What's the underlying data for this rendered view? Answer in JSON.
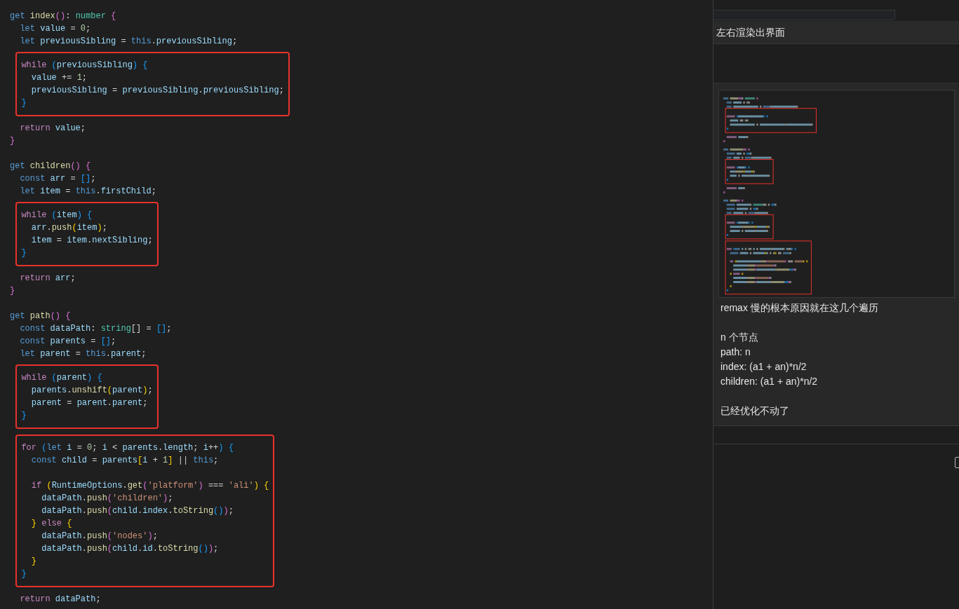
{
  "editor": {
    "blocks": [
      {
        "highlighted": false,
        "lines": [
          {
            "kind": "code",
            "tokens": [
              {
                "text": "get",
                "kind": "storage"
              },
              {
                "text": " index",
                "kind": "function"
              },
              {
                "text": "()",
                "kind": "bracket2"
              },
              {
                "text": ": ",
                "kind": "plain"
              },
              {
                "text": "number",
                "kind": "type"
              },
              {
                "text": " {",
                "kind": "bracket2"
              }
            ]
          },
          {
            "kind": "code",
            "tokens": [
              {
                "text": "  let",
                "kind": "storage"
              },
              {
                "text": " value",
                "kind": "variable"
              },
              {
                "text": " = ",
                "kind": "plain"
              },
              {
                "text": "0",
                "kind": "number"
              },
              {
                "text": ";",
                "kind": "plain"
              }
            ]
          },
          {
            "kind": "code",
            "tokens": [
              {
                "text": "  let",
                "kind": "storage"
              },
              {
                "text": " previousSibling",
                "kind": "variable"
              },
              {
                "text": " = ",
                "kind": "plain"
              },
              {
                "text": "this",
                "kind": "storage"
              },
              {
                "text": ".",
                "kind": "plain"
              },
              {
                "text": "previousSibling",
                "kind": "variable"
              },
              {
                "text": ";",
                "kind": "plain"
              }
            ]
          }
        ]
      },
      {
        "highlighted": true,
        "lines": [
          {
            "kind": "code",
            "tokens": [
              {
                "text": "  while",
                "kind": "control"
              },
              {
                "text": " (",
                "kind": "bracket3"
              },
              {
                "text": "previousSibling",
                "kind": "variable"
              },
              {
                "text": ")",
                "kind": "bracket3"
              },
              {
                "text": " {",
                "kind": "bracket3"
              }
            ]
          },
          {
            "kind": "code",
            "tokens": [
              {
                "text": "    value",
                "kind": "variable"
              },
              {
                "text": " += ",
                "kind": "plain"
              },
              {
                "text": "1",
                "kind": "number"
              },
              {
                "text": ";",
                "kind": "plain"
              }
            ]
          },
          {
            "kind": "code",
            "tokens": [
              {
                "text": "    previousSibling",
                "kind": "variable"
              },
              {
                "text": " = ",
                "kind": "plain"
              },
              {
                "text": "previousSibling",
                "kind": "variable"
              },
              {
                "text": ".",
                "kind": "plain"
              },
              {
                "text": "previousSibling",
                "kind": "variable"
              },
              {
                "text": ";",
                "kind": "plain"
              }
            ]
          },
          {
            "kind": "code",
            "tokens": [
              {
                "text": "  }",
                "kind": "bracket3"
              }
            ]
          }
        ]
      },
      {
        "highlighted": false,
        "lines": [
          {
            "kind": "code",
            "tokens": [
              {
                "text": "  return",
                "kind": "control"
              },
              {
                "text": " value",
                "kind": "variable"
              },
              {
                "text": ";",
                "kind": "plain"
              }
            ]
          },
          {
            "kind": "code",
            "tokens": [
              {
                "text": "}",
                "kind": "bracket2"
              }
            ]
          },
          {
            "kind": "blank"
          },
          {
            "kind": "code",
            "tokens": [
              {
                "text": "get",
                "kind": "storage"
              },
              {
                "text": " children",
                "kind": "function"
              },
              {
                "text": "()",
                "kind": "bracket2"
              },
              {
                "text": " {",
                "kind": "bracket2"
              }
            ]
          },
          {
            "kind": "code",
            "tokens": [
              {
                "text": "  const",
                "kind": "storage"
              },
              {
                "text": " arr",
                "kind": "variable"
              },
              {
                "text": " = ",
                "kind": "plain"
              },
              {
                "text": "[]",
                "kind": "bracket3"
              },
              {
                "text": ";",
                "kind": "plain"
              }
            ]
          },
          {
            "kind": "code",
            "tokens": [
              {
                "text": "  let",
                "kind": "storage"
              },
              {
                "text": " item",
                "kind": "variable"
              },
              {
                "text": " = ",
                "kind": "plain"
              },
              {
                "text": "this",
                "kind": "storage"
              },
              {
                "text": ".",
                "kind": "plain"
              },
              {
                "text": "firstChild",
                "kind": "variable"
              },
              {
                "text": ";",
                "kind": "plain"
              }
            ]
          }
        ]
      },
      {
        "highlighted": true,
        "lines": [
          {
            "kind": "code",
            "tokens": [
              {
                "text": "  while",
                "kind": "control"
              },
              {
                "text": " (",
                "kind": "bracket3"
              },
              {
                "text": "item",
                "kind": "variable"
              },
              {
                "text": ")",
                "kind": "bracket3"
              },
              {
                "text": " {",
                "kind": "bracket3"
              }
            ]
          },
          {
            "kind": "code",
            "tokens": [
              {
                "text": "    arr",
                "kind": "variable"
              },
              {
                "text": ".",
                "kind": "plain"
              },
              {
                "text": "push",
                "kind": "function"
              },
              {
                "text": "(",
                "kind": "bracket1"
              },
              {
                "text": "item",
                "kind": "variable"
              },
              {
                "text": ")",
                "kind": "bracket1"
              },
              {
                "text": ";",
                "kind": "plain"
              }
            ]
          },
          {
            "kind": "code",
            "tokens": [
              {
                "text": "    item",
                "kind": "variable"
              },
              {
                "text": " = ",
                "kind": "plain"
              },
              {
                "text": "item",
                "kind": "variable"
              },
              {
                "text": ".",
                "kind": "plain"
              },
              {
                "text": "nextSibling",
                "kind": "variable"
              },
              {
                "text": ";",
                "kind": "plain"
              }
            ]
          },
          {
            "kind": "code",
            "tokens": [
              {
                "text": "  }",
                "kind": "bracket3"
              }
            ]
          }
        ]
      },
      {
        "highlighted": false,
        "lines": [
          {
            "kind": "code",
            "tokens": [
              {
                "text": "  return",
                "kind": "control"
              },
              {
                "text": " arr",
                "kind": "variable"
              },
              {
                "text": ";",
                "kind": "plain"
              }
            ]
          },
          {
            "kind": "code",
            "tokens": [
              {
                "text": "}",
                "kind": "bracket2"
              }
            ]
          },
          {
            "kind": "blank"
          },
          {
            "kind": "code",
            "tokens": [
              {
                "text": "get",
                "kind": "storage"
              },
              {
                "text": " path",
                "kind": "function"
              },
              {
                "text": "()",
                "kind": "bracket2"
              },
              {
                "text": " {",
                "kind": "bracket2"
              }
            ]
          },
          {
            "kind": "code",
            "tokens": [
              {
                "text": "  const",
                "kind": "storage"
              },
              {
                "text": " dataPath",
                "kind": "variable"
              },
              {
                "text": ": ",
                "kind": "plain"
              },
              {
                "text": "string",
                "kind": "type"
              },
              {
                "text": "[]",
                "kind": "plain"
              },
              {
                "text": " = ",
                "kind": "plain"
              },
              {
                "text": "[]",
                "kind": "bracket3"
              },
              {
                "text": ";",
                "kind": "plain"
              }
            ]
          },
          {
            "kind": "code",
            "tokens": [
              {
                "text": "  const",
                "kind": "storage"
              },
              {
                "text": " parents",
                "kind": "variable"
              },
              {
                "text": " = ",
                "kind": "plain"
              },
              {
                "text": "[]",
                "kind": "bracket3"
              },
              {
                "text": ";",
                "kind": "plain"
              }
            ]
          },
          {
            "kind": "code",
            "tokens": [
              {
                "text": "  let",
                "kind": "storage"
              },
              {
                "text": " parent",
                "kind": "variable"
              },
              {
                "text": " = ",
                "kind": "plain"
              },
              {
                "text": "this",
                "kind": "storage"
              },
              {
                "text": ".",
                "kind": "plain"
              },
              {
                "text": "parent",
                "kind": "variable"
              },
              {
                "text": ";",
                "kind": "plain"
              }
            ]
          }
        ]
      },
      {
        "highlighted": true,
        "lines": [
          {
            "kind": "code",
            "tokens": [
              {
                "text": "  while",
                "kind": "control"
              },
              {
                "text": " (",
                "kind": "bracket3"
              },
              {
                "text": "parent",
                "kind": "variable"
              },
              {
                "text": ")",
                "kind": "bracket3"
              },
              {
                "text": " {",
                "kind": "bracket3"
              }
            ]
          },
          {
            "kind": "code",
            "tokens": [
              {
                "text": "    parents",
                "kind": "variable"
              },
              {
                "text": ".",
                "kind": "plain"
              },
              {
                "text": "unshift",
                "kind": "function"
              },
              {
                "text": "(",
                "kind": "bracket1"
              },
              {
                "text": "parent",
                "kind": "variable"
              },
              {
                "text": ")",
                "kind": "bracket1"
              },
              {
                "text": ";",
                "kind": "plain"
              }
            ]
          },
          {
            "kind": "code",
            "tokens": [
              {
                "text": "    parent",
                "kind": "variable"
              },
              {
                "text": " = ",
                "kind": "plain"
              },
              {
                "text": "parent",
                "kind": "variable"
              },
              {
                "text": ".",
                "kind": "plain"
              },
              {
                "text": "parent",
                "kind": "variable"
              },
              {
                "text": ";",
                "kind": "plain"
              }
            ]
          },
          {
            "kind": "code",
            "tokens": [
              {
                "text": "  }",
                "kind": "bracket3"
              }
            ]
          }
        ]
      },
      {
        "highlighted": true,
        "lines": [
          {
            "kind": "code",
            "tokens": [
              {
                "text": "  for",
                "kind": "control"
              },
              {
                "text": " (",
                "kind": "bracket3"
              },
              {
                "text": "let",
                "kind": "storage"
              },
              {
                "text": " i",
                "kind": "variable"
              },
              {
                "text": " = ",
                "kind": "plain"
              },
              {
                "text": "0",
                "kind": "number"
              },
              {
                "text": "; ",
                "kind": "plain"
              },
              {
                "text": "i",
                "kind": "variable"
              },
              {
                "text": " < ",
                "kind": "plain"
              },
              {
                "text": "parents",
                "kind": "variable"
              },
              {
                "text": ".",
                "kind": "plain"
              },
              {
                "text": "length",
                "kind": "variable"
              },
              {
                "text": "; ",
                "kind": "plain"
              },
              {
                "text": "i",
                "kind": "variable"
              },
              {
                "text": "++",
                "kind": "plain"
              },
              {
                "text": ")",
                "kind": "bracket3"
              },
              {
                "text": " {",
                "kind": "bracket3"
              }
            ]
          },
          {
            "kind": "code",
            "tokens": [
              {
                "text": "    const",
                "kind": "storage"
              },
              {
                "text": " child",
                "kind": "variable"
              },
              {
                "text": " = ",
                "kind": "plain"
              },
              {
                "text": "parents",
                "kind": "variable"
              },
              {
                "text": "[",
                "kind": "bracket1"
              },
              {
                "text": "i",
                "kind": "variable"
              },
              {
                "text": " + ",
                "kind": "plain"
              },
              {
                "text": "1",
                "kind": "number"
              },
              {
                "text": "]",
                "kind": "bracket1"
              },
              {
                "text": " || ",
                "kind": "plain"
              },
              {
                "text": "this",
                "kind": "storage"
              },
              {
                "text": ";",
                "kind": "plain"
              }
            ]
          },
          {
            "kind": "blank"
          },
          {
            "kind": "code",
            "tokens": [
              {
                "text": "    if",
                "kind": "control"
              },
              {
                "text": " (",
                "kind": "bracket1"
              },
              {
                "text": "RuntimeOptions",
                "kind": "variable"
              },
              {
                "text": ".",
                "kind": "plain"
              },
              {
                "text": "get",
                "kind": "function"
              },
              {
                "text": "(",
                "kind": "bracket2"
              },
              {
                "text": "'platform'",
                "kind": "string"
              },
              {
                "text": ")",
                "kind": "bracket2"
              },
              {
                "text": " === ",
                "kind": "plain"
              },
              {
                "text": "'ali'",
                "kind": "string"
              },
              {
                "text": ")",
                "kind": "bracket1"
              },
              {
                "text": " {",
                "kind": "bracket1"
              }
            ]
          },
          {
            "kind": "code",
            "tokens": [
              {
                "text": "      dataPath",
                "kind": "variable"
              },
              {
                "text": ".",
                "kind": "plain"
              },
              {
                "text": "push",
                "kind": "function"
              },
              {
                "text": "(",
                "kind": "bracket2"
              },
              {
                "text": "'children'",
                "kind": "string"
              },
              {
                "text": ")",
                "kind": "bracket2"
              },
              {
                "text": ";",
                "kind": "plain"
              }
            ]
          },
          {
            "kind": "code",
            "tokens": [
              {
                "text": "      dataPath",
                "kind": "variable"
              },
              {
                "text": ".",
                "kind": "plain"
              },
              {
                "text": "push",
                "kind": "function"
              },
              {
                "text": "(",
                "kind": "bracket2"
              },
              {
                "text": "child",
                "kind": "variable"
              },
              {
                "text": ".",
                "kind": "plain"
              },
              {
                "text": "index",
                "kind": "variable"
              },
              {
                "text": ".",
                "kind": "plain"
              },
              {
                "text": "toString",
                "kind": "function"
              },
              {
                "text": "()",
                "kind": "bracket3"
              },
              {
                "text": ")",
                "kind": "bracket2"
              },
              {
                "text": ";",
                "kind": "plain"
              }
            ]
          },
          {
            "kind": "code",
            "tokens": [
              {
                "text": "    }",
                "kind": "bracket1"
              },
              {
                "text": " else",
                "kind": "control"
              },
              {
                "text": " {",
                "kind": "bracket1"
              }
            ]
          },
          {
            "kind": "code",
            "tokens": [
              {
                "text": "      dataPath",
                "kind": "variable"
              },
              {
                "text": ".",
                "kind": "plain"
              },
              {
                "text": "push",
                "kind": "function"
              },
              {
                "text": "(",
                "kind": "bracket2"
              },
              {
                "text": "'nodes'",
                "kind": "string"
              },
              {
                "text": ")",
                "kind": "bracket2"
              },
              {
                "text": ";",
                "kind": "plain"
              }
            ]
          },
          {
            "kind": "code",
            "tokens": [
              {
                "text": "      dataPath",
                "kind": "variable"
              },
              {
                "text": ".",
                "kind": "plain"
              },
              {
                "text": "push",
                "kind": "function"
              },
              {
                "text": "(",
                "kind": "bracket2"
              },
              {
                "text": "child",
                "kind": "variable"
              },
              {
                "text": ".",
                "kind": "plain"
              },
              {
                "text": "id",
                "kind": "variable"
              },
              {
                "text": ".",
                "kind": "plain"
              },
              {
                "text": "toString",
                "kind": "function"
              },
              {
                "text": "()",
                "kind": "bracket3"
              },
              {
                "text": ")",
                "kind": "bracket2"
              },
              {
                "text": ";",
                "kind": "plain"
              }
            ]
          },
          {
            "kind": "code",
            "tokens": [
              {
                "text": "    }",
                "kind": "bracket1"
              }
            ]
          },
          {
            "kind": "code",
            "tokens": [
              {
                "text": "  }",
                "kind": "bracket3"
              }
            ]
          }
        ]
      },
      {
        "highlighted": false,
        "lines": [
          {
            "kind": "code",
            "tokens": [
              {
                "text": "  return",
                "kind": "control"
              },
              {
                "text": " dataPath",
                "kind": "variable"
              },
              {
                "text": ";",
                "kind": "plain"
              }
            ]
          }
        ]
      }
    ]
  },
  "chat": {
    "top_message": "左右渲染出界面",
    "message": {
      "paragraphs": [
        {
          "lines": [
            "remax 慢的根本原因就在这几个遍历"
          ]
        },
        {
          "lines": [
            "n 个节点",
            "path: n",
            "index: (a1 + an)*n/2",
            "children: (a1 + an)*n/2"
          ]
        },
        {
          "lines": [
            "已经优化不动了"
          ]
        }
      ]
    }
  }
}
